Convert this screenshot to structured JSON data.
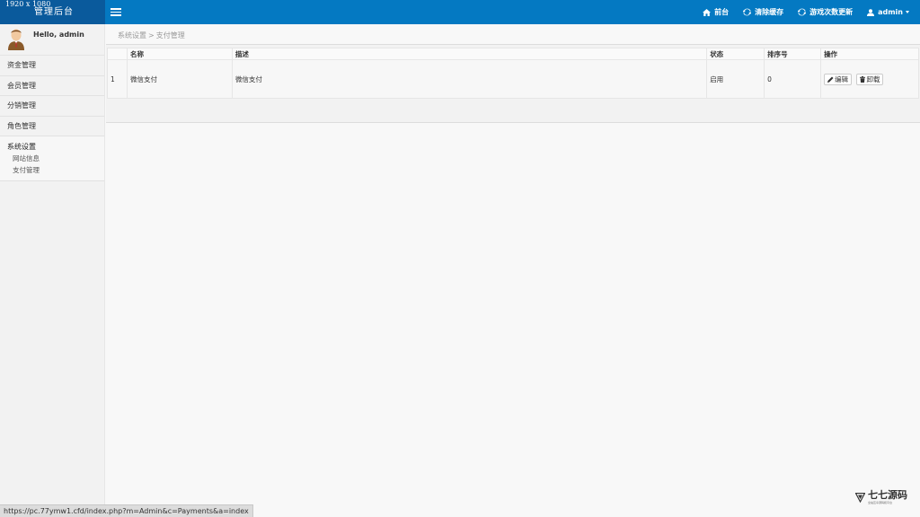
{
  "header": {
    "resolution_text": "1920 x 1080",
    "app_title": "管理后台",
    "nav": [
      {
        "label": "前台",
        "icon": "home-icon"
      },
      {
        "label": "清除缓存",
        "icon": "refresh-icon"
      },
      {
        "label": "游戏次数更新",
        "icon": "refresh-icon"
      },
      {
        "label": "admin",
        "icon": "user-icon"
      }
    ]
  },
  "sidebar": {
    "greeting": "Hello, admin",
    "items": [
      {
        "label": "资金管理"
      },
      {
        "label": "会员管理"
      },
      {
        "label": "分销管理"
      },
      {
        "label": "角色管理"
      }
    ],
    "group": {
      "title": "系统设置",
      "subitems": [
        {
          "label": "网站信息"
        },
        {
          "label": "支付管理"
        }
      ]
    }
  },
  "breadcrumb": {
    "parent": "系统设置",
    "separator": ">",
    "current": "支付管理"
  },
  "table": {
    "headers": [
      "",
      "名称",
      "描述",
      "状态",
      "排序号",
      "操作"
    ],
    "rows": [
      {
        "id": "1",
        "name": "微信支付",
        "desc": "微信支付",
        "status": "启用",
        "order": "0"
      }
    ],
    "edit_label": "编辑",
    "uninstall_label": "卸载"
  },
  "statusbar": {
    "url": "https://pc.77ymw1.cfd/index.php?m=Admin&c=Payments&a=index"
  },
  "watermark": {
    "title": "七七源码",
    "subtitle": "全站互享源码和平台"
  },
  "colors": {
    "topbar": "#0479c2",
    "logo_bg": "#0a5a9c",
    "sidebar_bg": "#f2f2f2",
    "page_bg": "#f8f8f8"
  }
}
